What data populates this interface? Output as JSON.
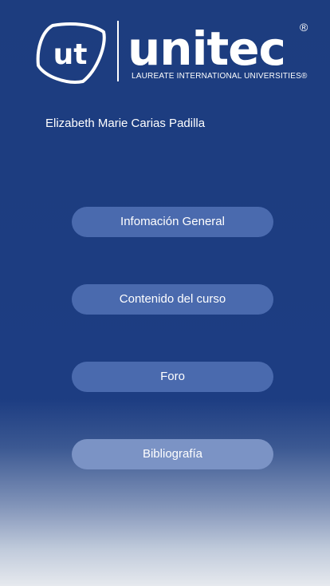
{
  "brand": {
    "logo_mark_text": "ut",
    "wordmark": "unitec",
    "registered_symbol": "®",
    "tagline": "LAUREATE INTERNATIONAL UNIVERSITIES®"
  },
  "user": {
    "name": "Elizabeth Marie Carias Padilla"
  },
  "menu": {
    "items": [
      {
        "label": "Infomación General"
      },
      {
        "label": "Contenido del curso"
      },
      {
        "label": "Foro"
      },
      {
        "label": "Bibliografía"
      }
    ]
  },
  "colors": {
    "background_top": "#1d3d7f",
    "background_bottom": "#e6e9ee",
    "button": "#4a6aae",
    "button_light": "#7b93c5",
    "text": "#ffffff"
  }
}
